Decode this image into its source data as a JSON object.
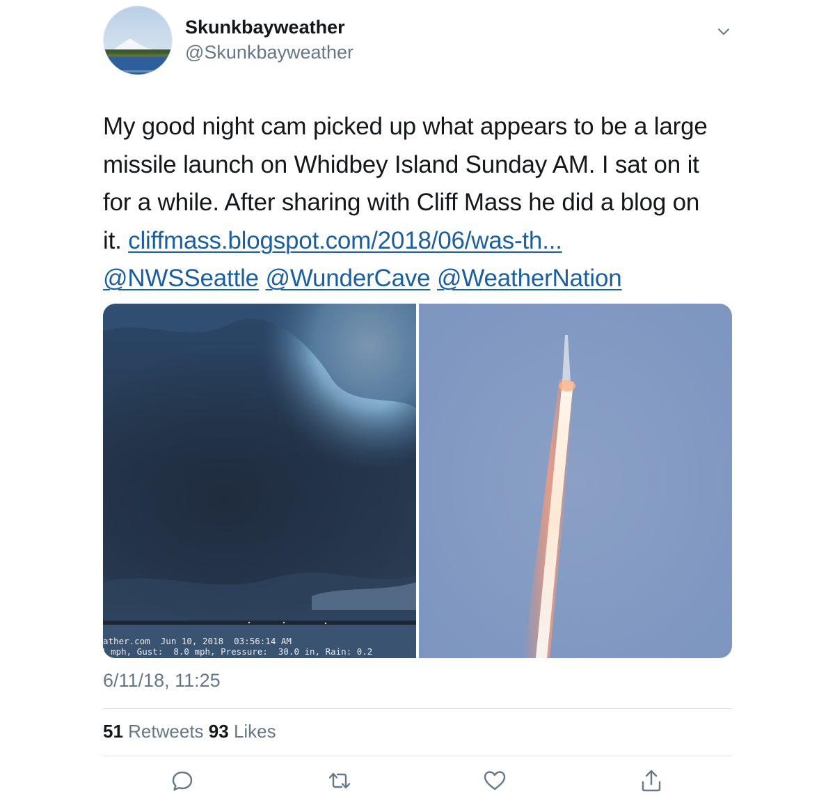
{
  "user": {
    "display_name": "Skunkbayweather",
    "handle": "@Skunkbayweather"
  },
  "tweet": {
    "text_lines": [
      "My good night cam picked up what appears to be a large",
      "missile launch on Whidbey Island Sunday AM. I sat on it",
      "for a while. After sharing with Cliff Mass he did a blog on"
    ],
    "line4_prefix": "it. ",
    "link": "cliffmass.blogspot.com/2018/06/was-th...",
    "mentions": [
      "@NWSSeattle",
      "@WunderCave",
      "@WeatherNation"
    ],
    "link_color": "#1b5fa0"
  },
  "media": {
    "left_photo": {
      "overlay_line1": "ather.com  Jun 10, 2018  03:56:14 AM",
      "overlay_line2": "4 mph, Gust:  8.0 mph, Pressure:  30.0 in, Rain: 0.2"
    },
    "right_photo": {}
  },
  "timestamp": "6/11/18, 11:25",
  "stats": {
    "retweets_count": "51",
    "retweets_label": "Retweets",
    "likes_count": "93",
    "likes_label": "Likes"
  },
  "actions": [
    "reply-icon",
    "retweet-icon",
    "like-icon",
    "share-icon"
  ],
  "colors": {
    "text": "#14171a",
    "secondary": "#657786",
    "divider": "#d9dee2"
  }
}
